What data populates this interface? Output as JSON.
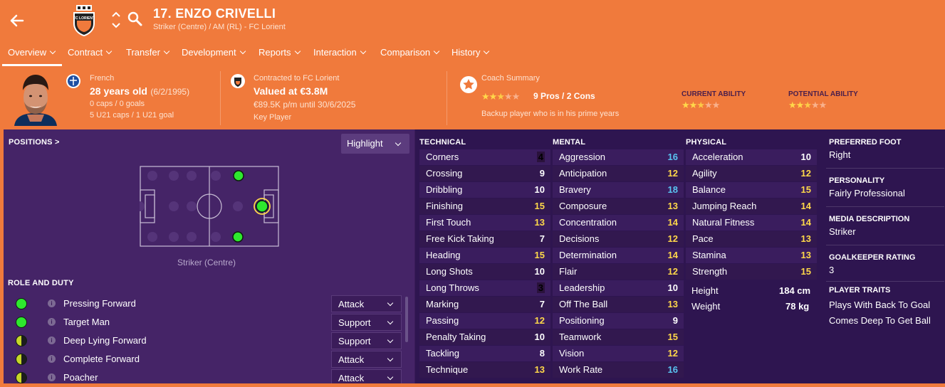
{
  "header": {
    "title": "17. ENZO CRIVELLI",
    "subtitle": "Striker (Centre) / AM (RL) - FC Lorient",
    "crest_text": "FC LORIENT"
  },
  "tabs": [
    {
      "label": "Overview"
    },
    {
      "label": "Contract"
    },
    {
      "label": "Transfer"
    },
    {
      "label": "Development"
    },
    {
      "label": "Reports"
    },
    {
      "label": "Interaction"
    },
    {
      "label": "Comparison"
    },
    {
      "label": "History"
    }
  ],
  "info": {
    "nationality": "French",
    "age": "28 years old",
    "dob": "(6/2/1995)",
    "caps": "0 caps / 0 goals",
    "u21": "5 U21 caps / 1 U21 goal",
    "contract_label": "Contracted to FC Lorient",
    "value": "Valued at €3.8M",
    "wage": "€89.5K p/m until 30/6/2025",
    "status": "Key Player",
    "coach_label": "Coach Summary",
    "pros_cons": "9 Pros / 2 Cons",
    "coach_text": "Backup player who is in his prime years",
    "coach_stars": 2.5,
    "current_ability_label": "CURRENT ABILITY",
    "current_ability_stars": 2.5,
    "potential_ability_label": "POTENTIAL ABILITY",
    "potential_ability_stars": 2.5
  },
  "positions": {
    "heading": "POSITIONS >",
    "highlight": "Highlight",
    "caption": "Striker (Centre)"
  },
  "roles": {
    "heading": "ROLE AND DUTY",
    "items": [
      {
        "name": "Pressing Forward",
        "duty": "Attack",
        "color": "#2ee82e"
      },
      {
        "name": "Target Man",
        "duty": "Support",
        "color": "#2ee82e"
      },
      {
        "name": "Deep Lying Forward",
        "duty": "Support",
        "color": "#c7d62a"
      },
      {
        "name": "Complete Forward",
        "duty": "Attack",
        "color": "#c7d62a"
      },
      {
        "name": "Poacher",
        "duty": "Attack",
        "color": "#c7d62a"
      }
    ]
  },
  "technical": {
    "heading": "TECHNICAL",
    "items": [
      {
        "name": "Corners",
        "value": "4"
      },
      {
        "name": "Crossing",
        "value": "9"
      },
      {
        "name": "Dribbling",
        "value": "10"
      },
      {
        "name": "Finishing",
        "value": "15"
      },
      {
        "name": "First Touch",
        "value": "13"
      },
      {
        "name": "Free Kick Taking",
        "value": "7"
      },
      {
        "name": "Heading",
        "value": "15"
      },
      {
        "name": "Long Shots",
        "value": "10"
      },
      {
        "name": "Long Throws",
        "value": "3"
      },
      {
        "name": "Marking",
        "value": "7"
      },
      {
        "name": "Passing",
        "value": "12"
      },
      {
        "name": "Penalty Taking",
        "value": "10"
      },
      {
        "name": "Tackling",
        "value": "8"
      },
      {
        "name": "Technique",
        "value": "13"
      }
    ]
  },
  "mental": {
    "heading": "MENTAL",
    "items": [
      {
        "name": "Aggression",
        "value": "16"
      },
      {
        "name": "Anticipation",
        "value": "12"
      },
      {
        "name": "Bravery",
        "value": "18"
      },
      {
        "name": "Composure",
        "value": "13"
      },
      {
        "name": "Concentration",
        "value": "14"
      },
      {
        "name": "Decisions",
        "value": "12"
      },
      {
        "name": "Determination",
        "value": "14"
      },
      {
        "name": "Flair",
        "value": "12"
      },
      {
        "name": "Leadership",
        "value": "10"
      },
      {
        "name": "Off The Ball",
        "value": "13"
      },
      {
        "name": "Positioning",
        "value": "9"
      },
      {
        "name": "Teamwork",
        "value": "15"
      },
      {
        "name": "Vision",
        "value": "12"
      },
      {
        "name": "Work Rate",
        "value": "16"
      }
    ]
  },
  "physical": {
    "heading": "PHYSICAL",
    "items": [
      {
        "name": "Acceleration",
        "value": "10"
      },
      {
        "name": "Agility",
        "value": "12"
      },
      {
        "name": "Balance",
        "value": "15"
      },
      {
        "name": "Jumping Reach",
        "value": "14"
      },
      {
        "name": "Natural Fitness",
        "value": "14"
      },
      {
        "name": "Pace",
        "value": "13"
      },
      {
        "name": "Stamina",
        "value": "13"
      },
      {
        "name": "Strength",
        "value": "15"
      }
    ],
    "height_label": "Height",
    "height": "184 cm",
    "weight_label": "Weight",
    "weight": "78 kg"
  },
  "details": {
    "preferred_foot_label": "PREFERRED FOOT",
    "preferred_foot": "Right",
    "personality_label": "PERSONALITY",
    "personality": "Fairly Professional",
    "media_label": "MEDIA DESCRIPTION",
    "media": "Striker",
    "gk_label": "GOALKEEPER RATING",
    "gk": "3",
    "traits_label": "PLAYER TRAITS",
    "traits": [
      "Plays With Back To Goal",
      "Comes Deep To Get Ball"
    ]
  },
  "colors": {
    "brand_orange": "#f07a3c",
    "panel_purple": "#452467",
    "attr_dark": "#2e1550",
    "value_good": "#ffd84a",
    "value_top": "#59c4f1"
  }
}
